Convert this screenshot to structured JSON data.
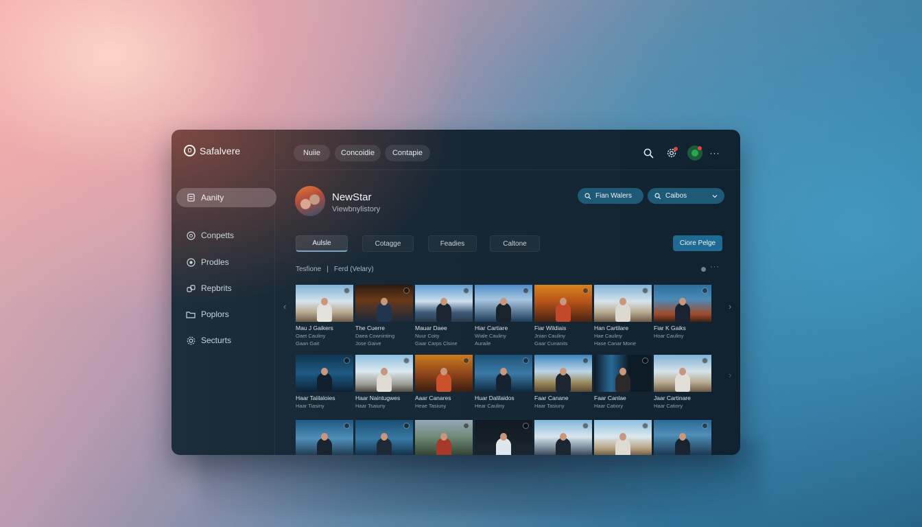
{
  "app": {
    "brand": "Safalvere"
  },
  "sidebar": {
    "items": [
      {
        "label": "Aanity",
        "icon": "document-icon",
        "active": true
      },
      {
        "label": "Conpetts",
        "icon": "circle-icon",
        "active": false
      },
      {
        "label": "Prodles",
        "icon": "target-icon",
        "active": false
      },
      {
        "label": "Repbrits",
        "icon": "link-icon",
        "active": false
      },
      {
        "label": "Poplors",
        "icon": "folder-icon",
        "active": false
      },
      {
        "label": "Secturts",
        "icon": "gear-icon",
        "active": false
      }
    ]
  },
  "topbar": {
    "pills": [
      "Nuiie",
      "Concoidie",
      "Contapie"
    ],
    "icons": [
      "search-icon",
      "settings-icon",
      "status-icon",
      "more-icon"
    ]
  },
  "profile": {
    "name": "NewStar",
    "subtitle": "Viewbnylistory"
  },
  "actions": [
    {
      "label": "Fian Walers",
      "icon": "search-icon"
    },
    {
      "label": "Caibos",
      "icon": "search-icon",
      "dropdown": true
    }
  ],
  "tabs": [
    "Aulsle",
    "Cotagge",
    "Feadies",
    "Caltone"
  ],
  "primary_button": "Ciore Pelge",
  "breadcrumb": {
    "left": "Tesfione",
    "sep": "|",
    "right": "Ferd (Velary)"
  },
  "colors": {
    "accent": "#1f6a92",
    "brand_orange": "#d8603f",
    "badge_red": "#e0453e",
    "status_green": "#2ea84e"
  },
  "rows": [
    [
      {
        "title": "Mau J Gaikers",
        "sub1": "Oaet Cauliny",
        "sub2": "Gaan Gait"
      },
      {
        "title": "The Cuerre",
        "sub1": "Daea Cowninting",
        "sub2": "Jose Gaive"
      },
      {
        "title": "Mauar Daee",
        "sub1": "Nuur Coity",
        "sub2": "Gaar Carps Clsine"
      },
      {
        "title": "Hiar Cartiare",
        "sub1": "Wiale Cauliny",
        "sub2": "Auraile"
      },
      {
        "title": "Fiar Wildiais",
        "sub1": "Jnian Cauliny",
        "sub2": "Gaar Cunanits"
      },
      {
        "title": "Han Cartilare",
        "sub1": "Hae Cauliny",
        "sub2": "Hase Canar Mone"
      },
      {
        "title": "Fiar K Gaiks",
        "sub1": "Hoar Cauliny",
        "sub2": ""
      }
    ],
    [
      {
        "title": "Haar Taiilaloies",
        "sub1": "Haar Tiasiny",
        "sub2": ""
      },
      {
        "title": "Haar Naintugwes",
        "sub1": "Haar Tsaiuny",
        "sub2": ""
      },
      {
        "title": "Aaar Canares",
        "sub1": "Heae Tasiuny",
        "sub2": ""
      },
      {
        "title": "Huar Dalilaidos",
        "sub1": "Hear Cauliny",
        "sub2": ""
      },
      {
        "title": "Faar Canane",
        "sub1": "Haar Tasiuny",
        "sub2": ""
      },
      {
        "title": "Faar Canlae",
        "sub1": "Haar Catiory",
        "sub2": ""
      },
      {
        "title": "Jaar Cartinare",
        "sub1": "Haar Catiory",
        "sub2": ""
      }
    ],
    [
      {
        "title": "",
        "sub1": "",
        "sub2": ""
      },
      {
        "title": "",
        "sub1": "",
        "sub2": ""
      },
      {
        "title": "",
        "sub1": "",
        "sub2": ""
      },
      {
        "title": "",
        "sub1": "",
        "sub2": ""
      },
      {
        "title": "",
        "sub1": "",
        "sub2": ""
      },
      {
        "title": "",
        "sub1": "",
        "sub2": ""
      },
      {
        "title": "",
        "sub1": "",
        "sub2": ""
      }
    ]
  ]
}
